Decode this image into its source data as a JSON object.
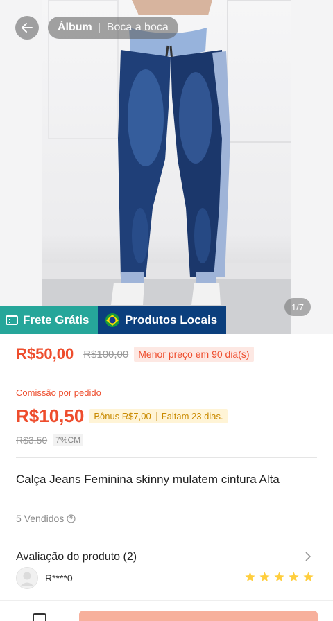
{
  "header": {
    "segments": [
      "Álbum",
      "Boca a boca"
    ],
    "image_counter": "1/7"
  },
  "badges": {
    "free_shipping": "Frete Grátis",
    "local_products": "Produtos Locais"
  },
  "price": {
    "current": "R$50,00",
    "original": "R$100,00",
    "lowest_tag": "Menor preço em 90 dia(s)"
  },
  "commission": {
    "label": "Comissão por pedido",
    "value": "R$10,50",
    "bonus": "Bônus R$7,00",
    "remaining": "Faltam 23 dias.",
    "old_value": "R$3,50",
    "rate": "7%CM"
  },
  "product": {
    "title": "Calça  Jeans Feminina skinny  mulatem cintura Alta",
    "sold": "5 Vendidos"
  },
  "reviews": {
    "title": "Avaliação do produto (2)",
    "reviewer": "R****0",
    "rating": 5
  },
  "colors": {
    "accent": "#ee4d2d",
    "ship_badge": "#26a69a",
    "local_badge": "#0b3f7d",
    "star": "#ffce3d",
    "buy_button": "#f7b09c"
  }
}
